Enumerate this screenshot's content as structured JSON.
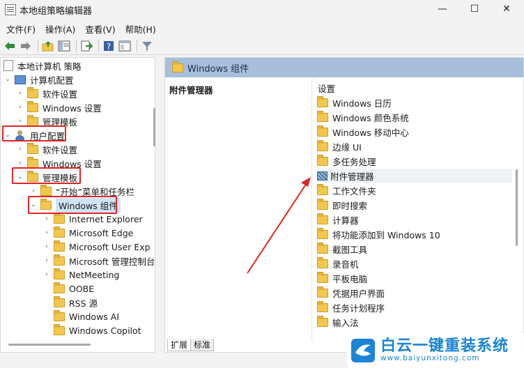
{
  "window": {
    "title": "本地组策略编辑器",
    "controls": {
      "minimize": "—",
      "maximize": "☐",
      "close": "✕"
    }
  },
  "menu": [
    "文件(F)",
    "操作(A)",
    "查看(V)",
    "帮助(H)"
  ],
  "toolbar": [
    "back-arrow-icon",
    "forward-arrow-icon",
    "up-folder-icon",
    "properties-icon",
    "export-icon",
    "help-icon",
    "extended-view-icon",
    "filter-icon"
  ],
  "tree": {
    "root": "本地计算机 策略",
    "computer_config": "计算机配置",
    "software_settings_1": "软件设置",
    "windows_settings_1": "Windows 设置",
    "admin_templates_1": "管理模板",
    "user_config": "用户配置",
    "software_settings_2": "软件设置",
    "windows_settings_2": "Windows 设置",
    "admin_templates_2": "管理模板",
    "start_menu": "“开始”菜单和任务栏",
    "windows_components": "Windows 组件",
    "children": [
      "Internet Explorer",
      "Microsoft Edge",
      "Microsoft User Exp",
      "Microsoft 管理控制台",
      "NetMeeting",
      "OOBE",
      "RSS 源",
      "Windows AI",
      "Windows Copilot"
    ]
  },
  "right": {
    "header": "Windows 组件",
    "description_title": "附件管理器",
    "column_header": "设置",
    "items": [
      "Windows 日历",
      "Windows 颜色系统",
      "Windows 移动中心",
      "边缘 UI",
      "多任务处理",
      "附件管理器",
      "工作文件夹",
      "即时搜索",
      "计算器",
      "将功能添加到 Windows 10",
      "截图工具",
      "录音机",
      "平板电脑",
      "凭据用户界面",
      "任务计划程序",
      "输入法"
    ]
  },
  "tabs": {
    "extended": "扩展",
    "standard": "标准"
  },
  "watermark": {
    "text": "白云一键重装系统",
    "url": "www.baiyunxitong.com"
  },
  "colors": {
    "annotation_red": "#e02424",
    "header_blue": "#a7bfdb",
    "folder_yellow": "#f3c74e",
    "watermark_blue": "#1a84d6"
  }
}
